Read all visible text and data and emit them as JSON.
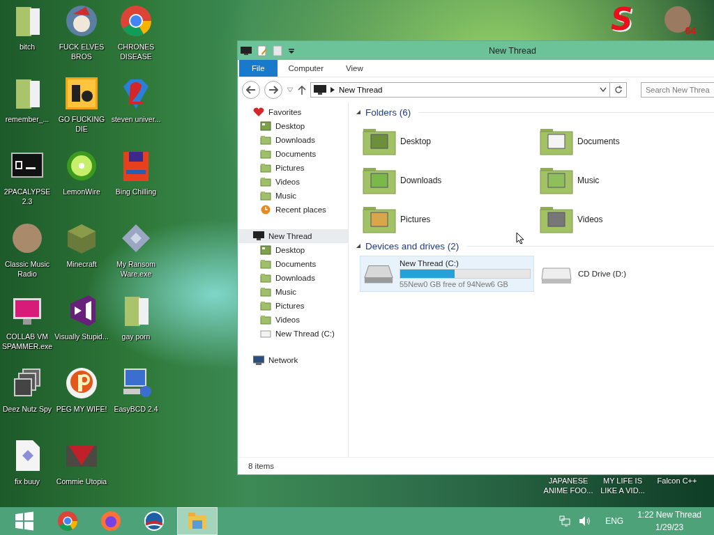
{
  "desktop": {
    "icons": [
      {
        "label": "bitch",
        "kind": "folder"
      },
      {
        "label": "FUCK ELVES BROS",
        "kind": "ball"
      },
      {
        "label": "CHRONES DISEASE",
        "kind": "chrome"
      },
      {
        "label": "remember_...",
        "kind": "folder"
      },
      {
        "label": "GO FUCKING DIE",
        "kind": "tile"
      },
      {
        "label": "steven univer...",
        "kind": "gem"
      },
      {
        "label": "2PACALYPSE 2.3",
        "kind": "terminal"
      },
      {
        "label": "LemonWire",
        "kind": "lime"
      },
      {
        "label": "Bing Chilling",
        "kind": "floppy"
      },
      {
        "label": "Classic Music Radio",
        "kind": "portrait"
      },
      {
        "label": "Minecraft",
        "kind": "cube"
      },
      {
        "label": "My Ransom Ware.exe",
        "kind": "diamond"
      },
      {
        "label": "COLLAB VM SPAMMER.exe",
        "kind": "monitor"
      },
      {
        "label": "Visually Stupid...",
        "kind": "bowtie"
      },
      {
        "label": "gay porn",
        "kind": "folder"
      },
      {
        "label": "Deez Nutz Spy",
        "kind": "stack"
      },
      {
        "label": "PEG MY WIFE!",
        "kind": "pball"
      },
      {
        "label": "EasyBCD 2.4",
        "kind": "computer"
      },
      {
        "label": "fix buuy",
        "kind": "document"
      },
      {
        "label": "Commie Utopia",
        "kind": "flag"
      }
    ],
    "corner_logo": "S",
    "corner_avatar_badge": "64",
    "partial_icons": [
      {
        "label": "JAPANESE ANIME FOO..."
      },
      {
        "label": "MY LIFE IS LIKE A VID..."
      },
      {
        "label": "Falcon C++"
      }
    ]
  },
  "explorer": {
    "title": "New Thread",
    "ribbon_tabs": [
      {
        "label": "File",
        "kind": "file",
        "selected": false
      },
      {
        "label": "Computer",
        "kind": "tab",
        "selected": false
      },
      {
        "label": "View",
        "kind": "tab",
        "selected": false
      }
    ],
    "address": "New Thread",
    "search": {
      "placeholder": "Search New Threa"
    },
    "nav": [
      {
        "label": "Favorites",
        "kind": "heart",
        "selected": false,
        "children": [
          {
            "label": "Desktop",
            "kind": "desktop",
            "selected": false
          },
          {
            "label": "Downloads",
            "kind": "folder",
            "selected": false
          },
          {
            "label": "Documents",
            "kind": "folder",
            "selected": false
          },
          {
            "label": "Pictures",
            "kind": "folder",
            "selected": false
          },
          {
            "label": "Videos",
            "kind": "folder",
            "selected": false
          },
          {
            "label": "Music",
            "kind": "folder",
            "selected": false
          },
          {
            "label": "Recent places",
            "kind": "recent",
            "selected": false
          }
        ]
      },
      {
        "label": "New Thread",
        "kind": "computer",
        "selected": true,
        "children": [
          {
            "label": "Desktop",
            "kind": "desktop",
            "selected": false
          },
          {
            "label": "Documents",
            "kind": "folder",
            "selected": false
          },
          {
            "label": "Downloads",
            "kind": "folder",
            "selected": false
          },
          {
            "label": "Music",
            "kind": "folder",
            "selected": false
          },
          {
            "label": "Pictures",
            "kind": "folder",
            "selected": false
          },
          {
            "label": "Videos",
            "kind": "folder",
            "selected": false
          },
          {
            "label": "New Thread (C:)",
            "kind": "drive",
            "selected": false
          }
        ]
      },
      {
        "label": "Network",
        "kind": "network",
        "selected": false
      }
    ],
    "folders": {
      "heading": "Folders (6)",
      "expanded": true,
      "items": [
        {
          "label": "Desktop",
          "kind": "desktop"
        },
        {
          "label": "Documents",
          "kind": "documents"
        },
        {
          "label": "Downloads",
          "kind": "downloads"
        },
        {
          "label": "Music",
          "kind": "music"
        },
        {
          "label": "Pictures",
          "kind": "pictures"
        },
        {
          "label": "Videos",
          "kind": "videos"
        }
      ]
    },
    "drives": {
      "heading": "Devices and drives (2)",
      "expanded": true,
      "items": [
        {
          "label": "New Thread (C:)",
          "kind": "hdd",
          "selected": true,
          "level": 0.42,
          "info": "55New0 GB free of 94New6 GB"
        },
        {
          "label": "CD Drive (D:)",
          "kind": "cd",
          "selected": false
        }
      ]
    },
    "status": "8 items"
  },
  "taskbar": {
    "apps": [
      {
        "kind": "start",
        "selected": false
      },
      {
        "kind": "chrome",
        "selected": false
      },
      {
        "kind": "firefox",
        "selected": false
      },
      {
        "kind": "emblem",
        "selected": false
      },
      {
        "kind": "explorer",
        "selected": true
      }
    ],
    "language": "ENG",
    "time": "1:22 New Thread",
    "date": "1/29/23"
  }
}
